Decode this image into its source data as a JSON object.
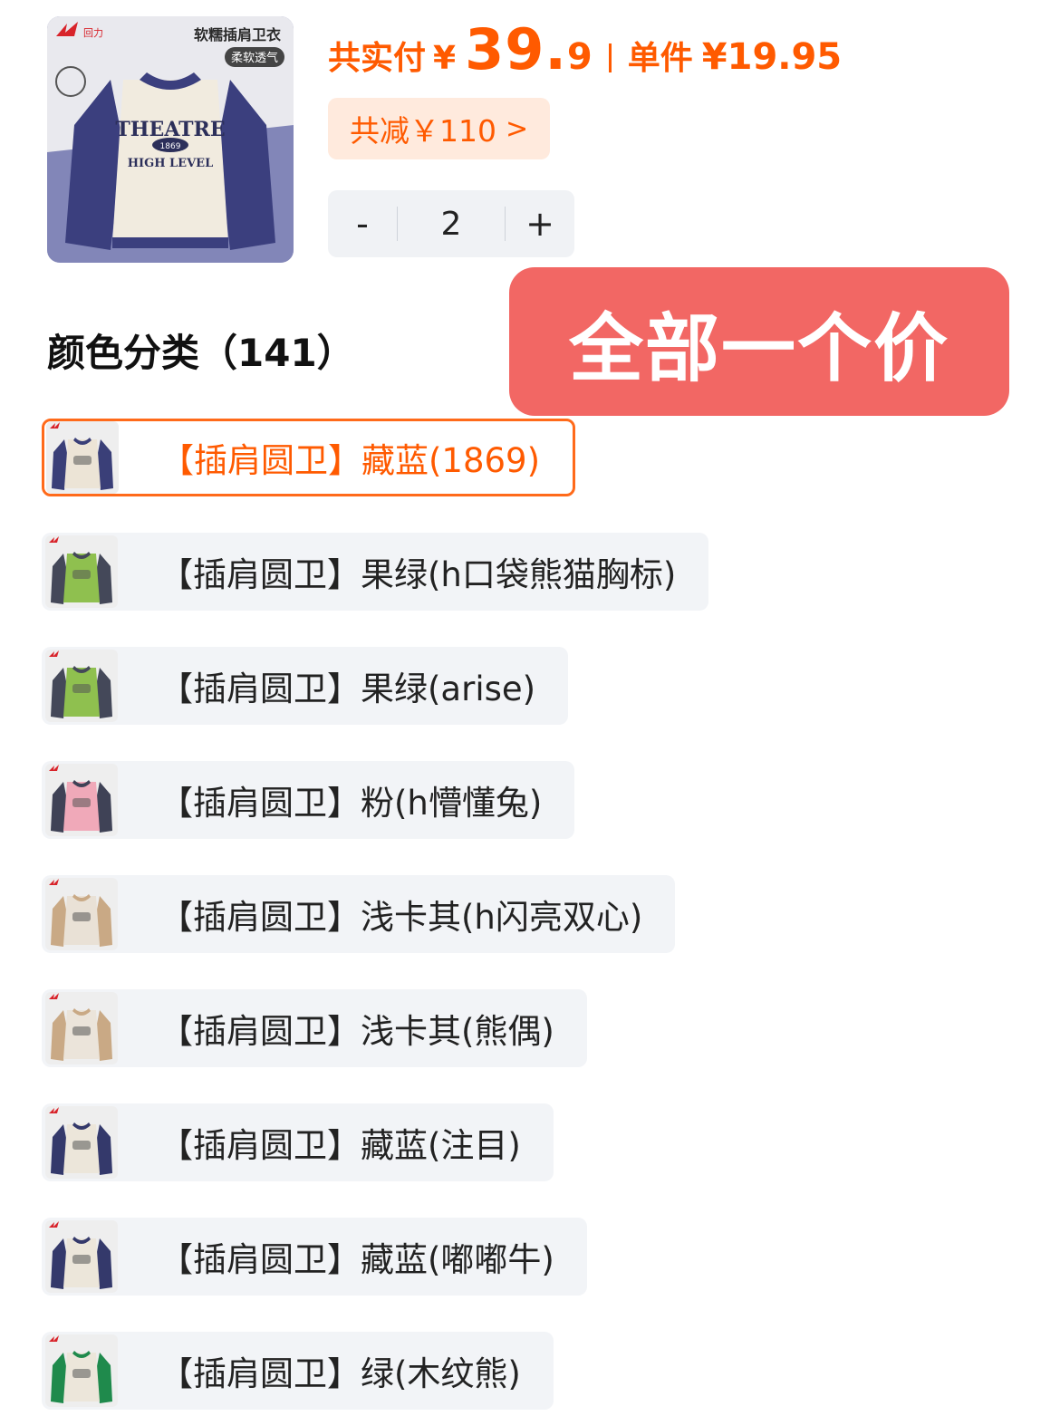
{
  "product": {
    "image_icon": "sweatshirt-product-image",
    "image_caption": "软糯插肩卫衣",
    "image_tag": "柔软透气",
    "image_print": [
      "THEATRE",
      "1869",
      "HIGH LEVEL"
    ],
    "brand_mark": "回力"
  },
  "price": {
    "total_label": "共实付",
    "currency": "¥",
    "total_int": "39.",
    "total_dec": "9",
    "unit_label": "单件",
    "unit_price": "¥19.95",
    "discount_text": "共减￥110",
    "discount_chevron": ">"
  },
  "quantity": {
    "minus": "-",
    "value": "2",
    "plus": "+"
  },
  "overlay": {
    "text": "全部一个价"
  },
  "options_section": {
    "title": "颜色分类（141）"
  },
  "options": [
    {
      "label": "【插肩圆卫】藏蓝(1869)",
      "selected": true,
      "color": "#3a3f78",
      "body": "#ece4d6"
    },
    {
      "label": "【插肩圆卫】果绿(h口袋熊猫胸标)",
      "selected": false,
      "color": "#444859",
      "body": "#8fc04f"
    },
    {
      "label": "【插肩圆卫】果绿(arise)",
      "selected": false,
      "color": "#444859",
      "body": "#8fc04f"
    },
    {
      "label": "【插肩圆卫】粉(h懵懂兔)",
      "selected": false,
      "color": "#3f4256",
      "body": "#f0a9b9"
    },
    {
      "label": "【插肩圆卫】浅卡其(h闪亮双心)",
      "selected": false,
      "color": "#c9a985",
      "body": "#e9e1d6"
    },
    {
      "label": "【插肩圆卫】浅卡其(熊偶)",
      "selected": false,
      "color": "#c9a985",
      "body": "#ebe4da"
    },
    {
      "label": "【插肩圆卫】藏蓝(注目)",
      "selected": false,
      "color": "#34396b",
      "body": "#ece6da"
    },
    {
      "label": "【插肩圆卫】藏蓝(嘟嘟牛)",
      "selected": false,
      "color": "#34396b",
      "body": "#ece6da"
    },
    {
      "label": "【插肩圆卫】绿(木纹熊)",
      "selected": false,
      "color": "#1f8a4c",
      "body": "#ece6da"
    }
  ],
  "colors": {
    "accent": "#ff5a00",
    "overlay_bg": "#f26764",
    "option_bg": "#f2f4f7",
    "selected_border": "#ff6a1a"
  }
}
